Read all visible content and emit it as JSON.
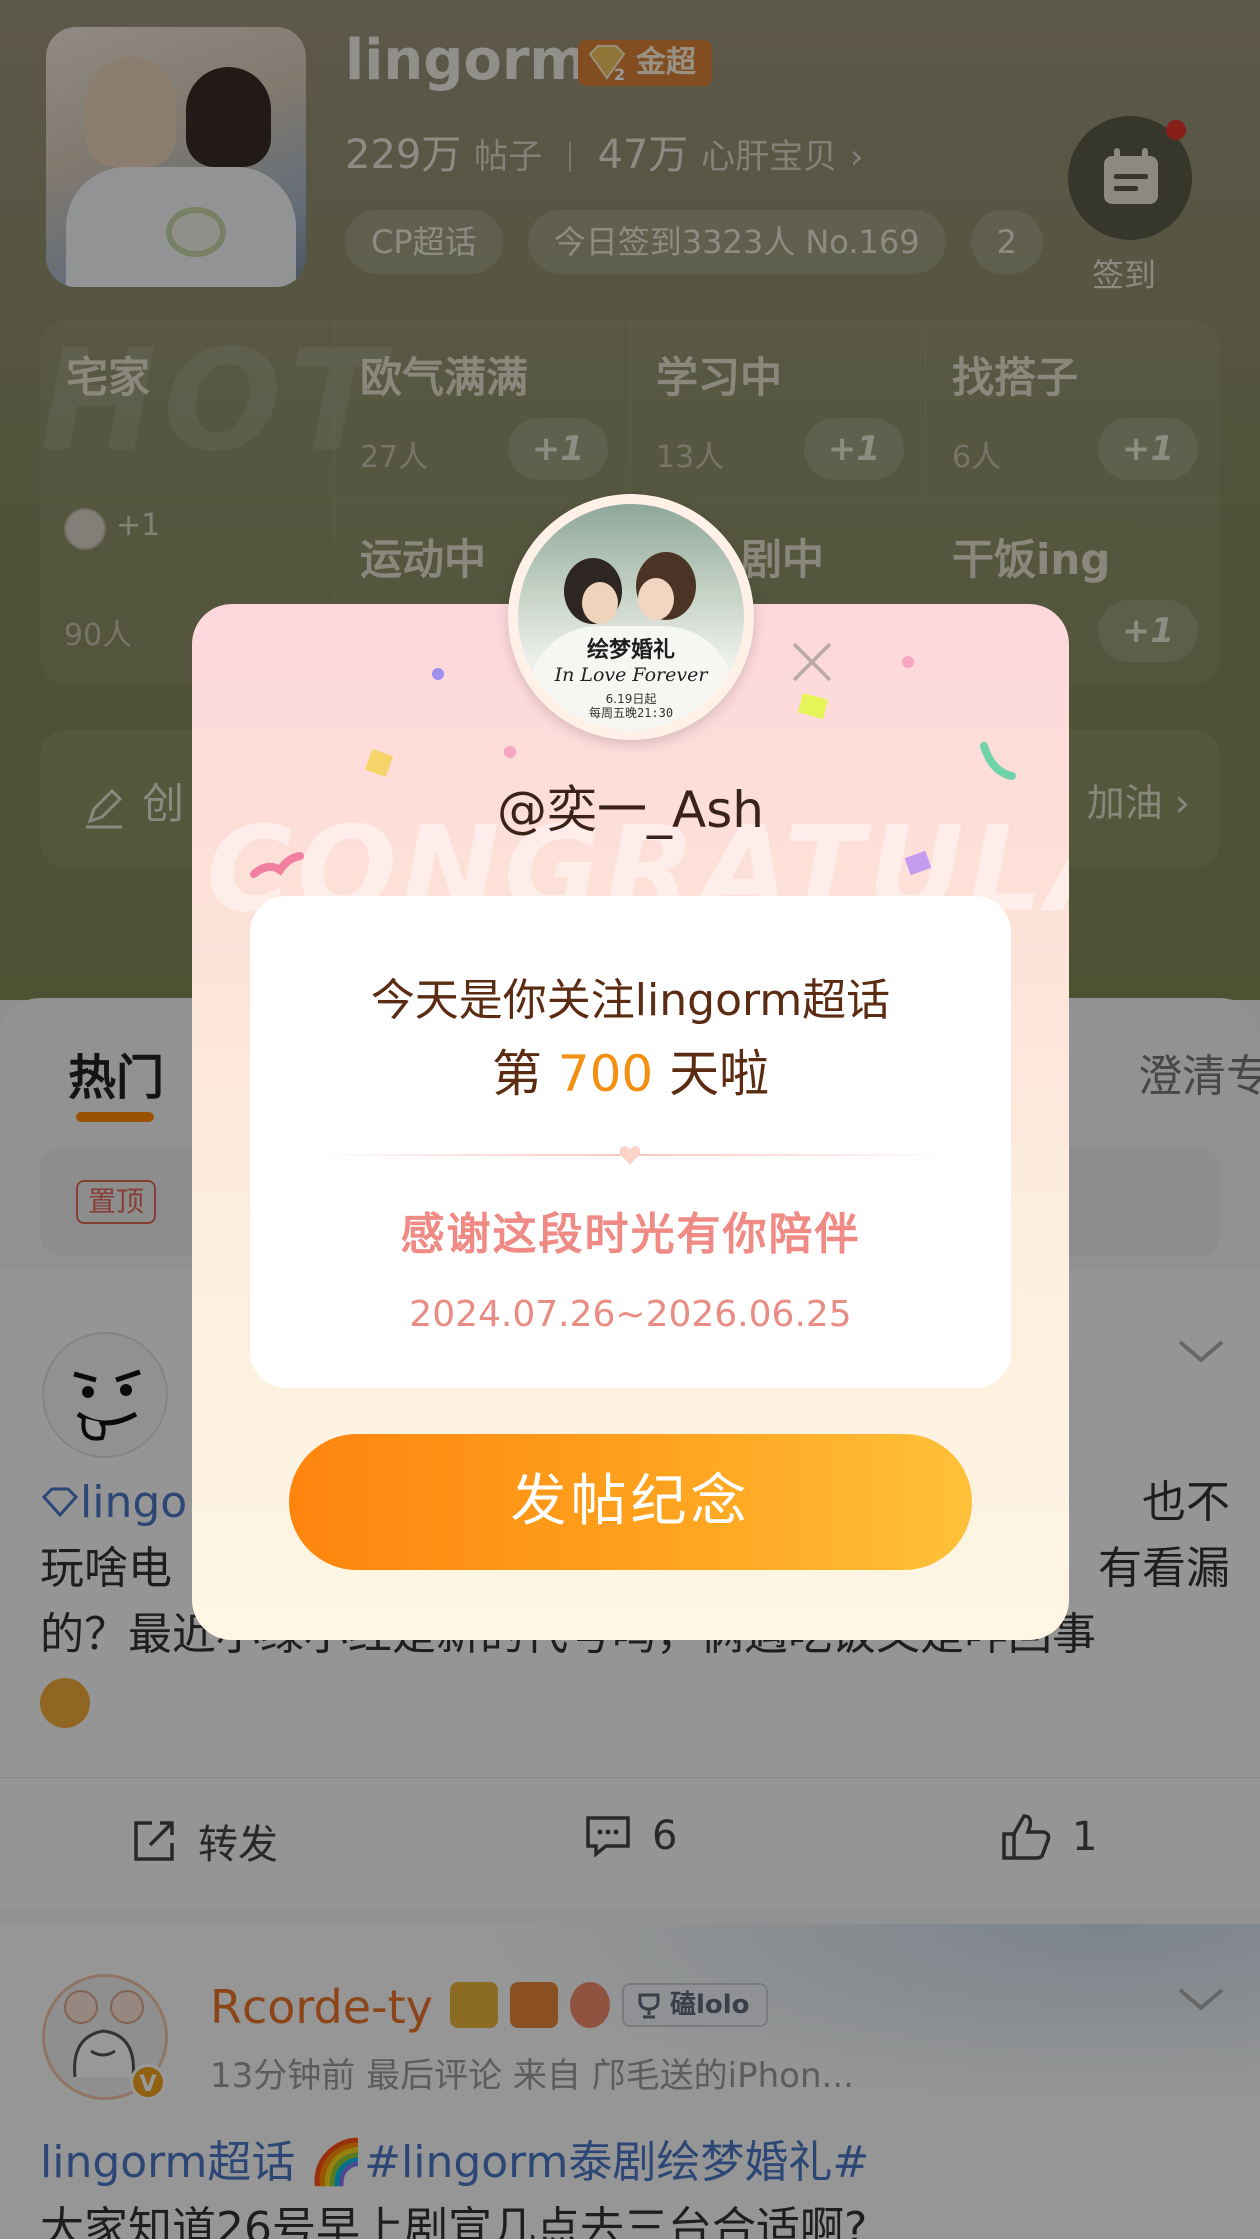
{
  "header": {
    "topic_name": "lingorm",
    "badge_label": "金超",
    "posts_count": "229万",
    "posts_unit": "帖子",
    "fans_count": "47万",
    "fans_unit": "心肝宝贝",
    "chevron": "›",
    "chips": [
      "CP超话",
      "今日签到3323人 No.169",
      "2"
    ],
    "checkin_label": "签到"
  },
  "moods": {
    "bg_text": "HOT",
    "first": {
      "title": "宅家",
      "count": "90人",
      "plus_text": "+1"
    },
    "cells": [
      {
        "title": "欧气满满",
        "count": "27人",
        "button": "+1"
      },
      {
        "title": "学习中",
        "count": "13人",
        "button": "+1"
      },
      {
        "title": "找搭子",
        "count": "6人",
        "button": "+1"
      },
      {
        "title": "运动中",
        "count": "",
        "button": ""
      },
      {
        "title": "剧中",
        "count": "",
        "button": ""
      },
      {
        "title": "干饭ing",
        "count": "",
        "button": "+1"
      }
    ]
  },
  "bar2": {
    "left": "创",
    "right": "加油 ›"
  },
  "feed": {
    "tab_active": "热门",
    "tab_right": "澄清专",
    "pinned_tag": "置顶",
    "post1": {
      "line1_tag": "lingo",
      "line1_end": "也不",
      "line2_start": "玩啥电",
      "line2_end": "有看漏",
      "line3": "的？最近小绿小红是新的代号吗，俩遇吃饭又是咋回事",
      "actions": {
        "repost": "转发",
        "comments": "6",
        "likes": "1"
      }
    },
    "post2": {
      "username": "Rcorde-ty",
      "fan_badge": "磕lolo",
      "meta": "13分钟前  最后评论    来自 邝毛送的iPhon...",
      "line1": "lingorm超话  🌈#lingorm泰剧绘梦婚礼#",
      "line2": "大家知道26号早上剧宣几点去三台合适啊?",
      "v_badge": "V"
    }
  },
  "modal": {
    "bg_text": "CONGRATULATE",
    "avatar_title": "绘梦婚礼",
    "avatar_script": "In Love Forever",
    "avatar_date": "6.19日起",
    "avatar_time": "每周五晚21:30",
    "handle": "@奕一_Ash",
    "line1": "今天是你关注lingorm超话",
    "line2_prefix": "第 ",
    "days": "700",
    "line2_suffix": " 天啦",
    "thanks": "感谢这段时光有你陪伴",
    "date_range": "2024.07.26~2026.06.25",
    "button": "发帖纪念"
  },
  "colors": {
    "accent_orange": "#ff8a00",
    "topic_link_blue": "#4a76c4",
    "thanks_pink": "#f08a84"
  }
}
